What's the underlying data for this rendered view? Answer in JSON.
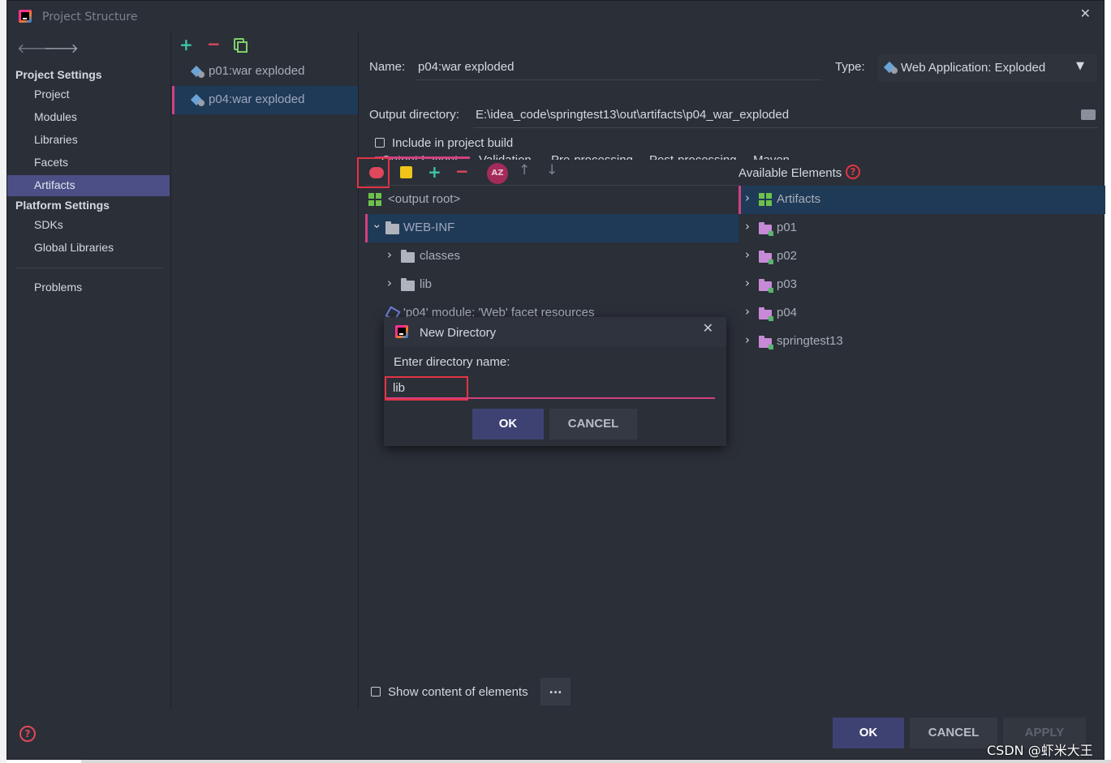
{
  "window": {
    "title": "Project Structure",
    "close_glyph": "✕"
  },
  "nav": {
    "back_glyph": "🡐",
    "forward_glyph": "🡒",
    "project_settings_header": "Project Settings",
    "project_settings_items": [
      "Project",
      "Modules",
      "Libraries",
      "Facets",
      "Artifacts"
    ],
    "platform_settings_header": "Platform Settings",
    "platform_settings_items": [
      "SDKs",
      "Global Libraries"
    ],
    "problems": "Problems",
    "selected": "Artifacts"
  },
  "artifacts_list": {
    "add_glyph": "+",
    "remove_glyph": "−",
    "items": [
      "p01:war exploded",
      "p04:war exploded"
    ],
    "selected": "p04:war exploded"
  },
  "artifact": {
    "name_label": "Name:",
    "name_value": "p04:war exploded",
    "type_label": "Type:",
    "type_value": "Web Application: Exploded",
    "type_arrow": "▼",
    "output_dir_label": "Output directory:",
    "output_dir_value": "E:\\idea_code\\springtest13\\out\\artifacts\\p04_war_exploded",
    "include_in_build_label": "Include in project build",
    "include_in_build_checked": false,
    "tabs": [
      "Output Layout",
      "Validation",
      "Pre-processing",
      "Post-processing",
      "Maven"
    ]
  },
  "toolbar": {
    "add_glyph": "+",
    "remove_glyph": "−",
    "sort_label": "AZ",
    "up_glyph": "↑",
    "down_glyph": "↓"
  },
  "output_tree": {
    "root": "<output root>",
    "expand_open": "⌄",
    "expand_closed": "›",
    "web_inf": "WEB-INF",
    "children": [
      "classes",
      "lib"
    ],
    "facet_resources": "'p04' module: 'Web' facet resources"
  },
  "available": {
    "label": "Available Elements",
    "help_glyph": "?",
    "items": [
      "Artifacts",
      "p01",
      "p02",
      "p03",
      "p04",
      "springtest13"
    ]
  },
  "show_content": {
    "label": "Show content of elements",
    "checked": false,
    "more_label": "..."
  },
  "footer": {
    "help_glyph": "?",
    "ok": "OK",
    "cancel": "CANCEL",
    "apply": "APPLY",
    "watermark": "CSDN @虾米大王"
  },
  "dialog": {
    "title": "New Directory",
    "close_glyph": "✕",
    "prompt": "Enter directory name:",
    "input_value": "lib",
    "ok": "OK",
    "cancel": "CANCEL"
  },
  "colors": {
    "bg": "#2b2f38",
    "selection": "#1f3a57",
    "accent_pink": "#d2407f",
    "highlight_red": "#e33442",
    "nav_selected": "#4b4f86",
    "ok_button": "#3e4272"
  }
}
